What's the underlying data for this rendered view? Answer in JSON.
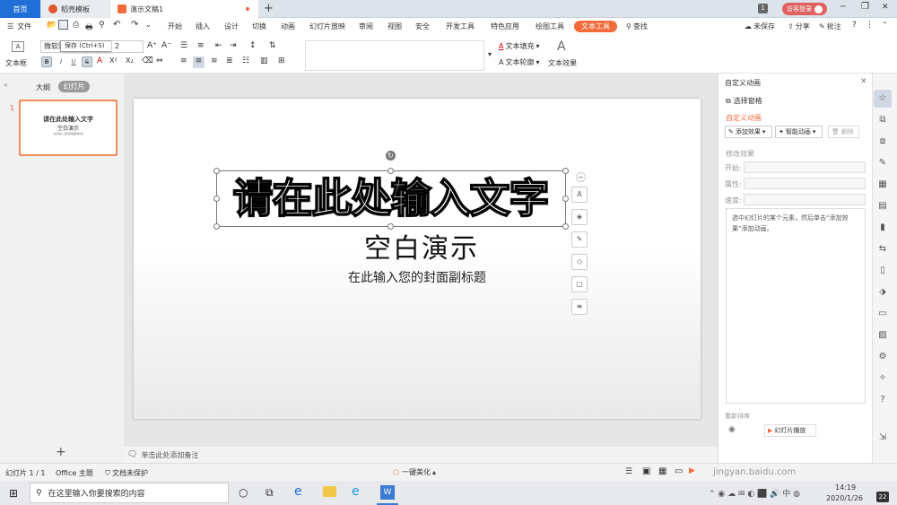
{
  "tabs": {
    "home": "首页",
    "templates": "稻壳模板",
    "doc": "演示文稿1",
    "add": "+"
  },
  "titlebar": {
    "count": "1",
    "login": "访客登录",
    "min": "─",
    "restore": "❐",
    "close": "✕"
  },
  "menu": {
    "file": "文件",
    "items": [
      "开始",
      "插入",
      "设计",
      "切换",
      "动画",
      "幻灯片放映",
      "审阅",
      "视图",
      "安全",
      "开发工具",
      "特色应用",
      "绘图工具",
      "文本工具"
    ],
    "search": "查找",
    "unsaved": "未保存",
    "share": "分享",
    "comment": "批注"
  },
  "ribbon": {
    "textbox_label": "文本框",
    "font_name": "微软雅",
    "font_size": "2",
    "tooltip": "保存 (Ctrl+S)",
    "text_fill": "文本填充",
    "text_outline": "文本轮廓",
    "text_effect": "文本效果",
    "art_letter": "A",
    "bold": "B",
    "italic": "I",
    "underline": "U",
    "strike": "S"
  },
  "leftpane": {
    "outline": "大纲",
    "slides": "幻灯片",
    "slide_number": "1",
    "thumb_title": "请在此处输入文字",
    "thumb_sub": "空白演示",
    "thumb_small": "在此输入您的封面副标题",
    "add": "+"
  },
  "slide": {
    "title": "请在此处输入文字",
    "subtitle": "空白演示",
    "caption": "在此输入您的封面副标题"
  },
  "notes": {
    "placeholder": "单击此处添加备注"
  },
  "panel": {
    "title": "自定义动画",
    "select_pane": "选择窗格",
    "section": "自定义动画",
    "add_effect": "添加效果",
    "smart_anim": "智能动画",
    "delete": "删除",
    "modify": "修改效果",
    "start": "开始:",
    "prop": "属性:",
    "speed": "速度:",
    "hint": "选中幻灯片的某个元素，然后单击“添加效果”添加动画。",
    "reorder": "重新排序",
    "play": "幻灯片播放"
  },
  "status": {
    "slide_info": "幻灯片 1 / 1",
    "theme": "Office 主题",
    "protect": "文档未保护",
    "beautify": "一键美化",
    "watermark": "jingyan.baidu.com"
  },
  "taskbar": {
    "search_placeholder": "在这里输入你要搜索的内容",
    "time": "14:19",
    "date": "2020/1/26",
    "notif": "22"
  },
  "colors": {
    "accent": "#f26b3a",
    "blue": "#1f6fd6"
  }
}
